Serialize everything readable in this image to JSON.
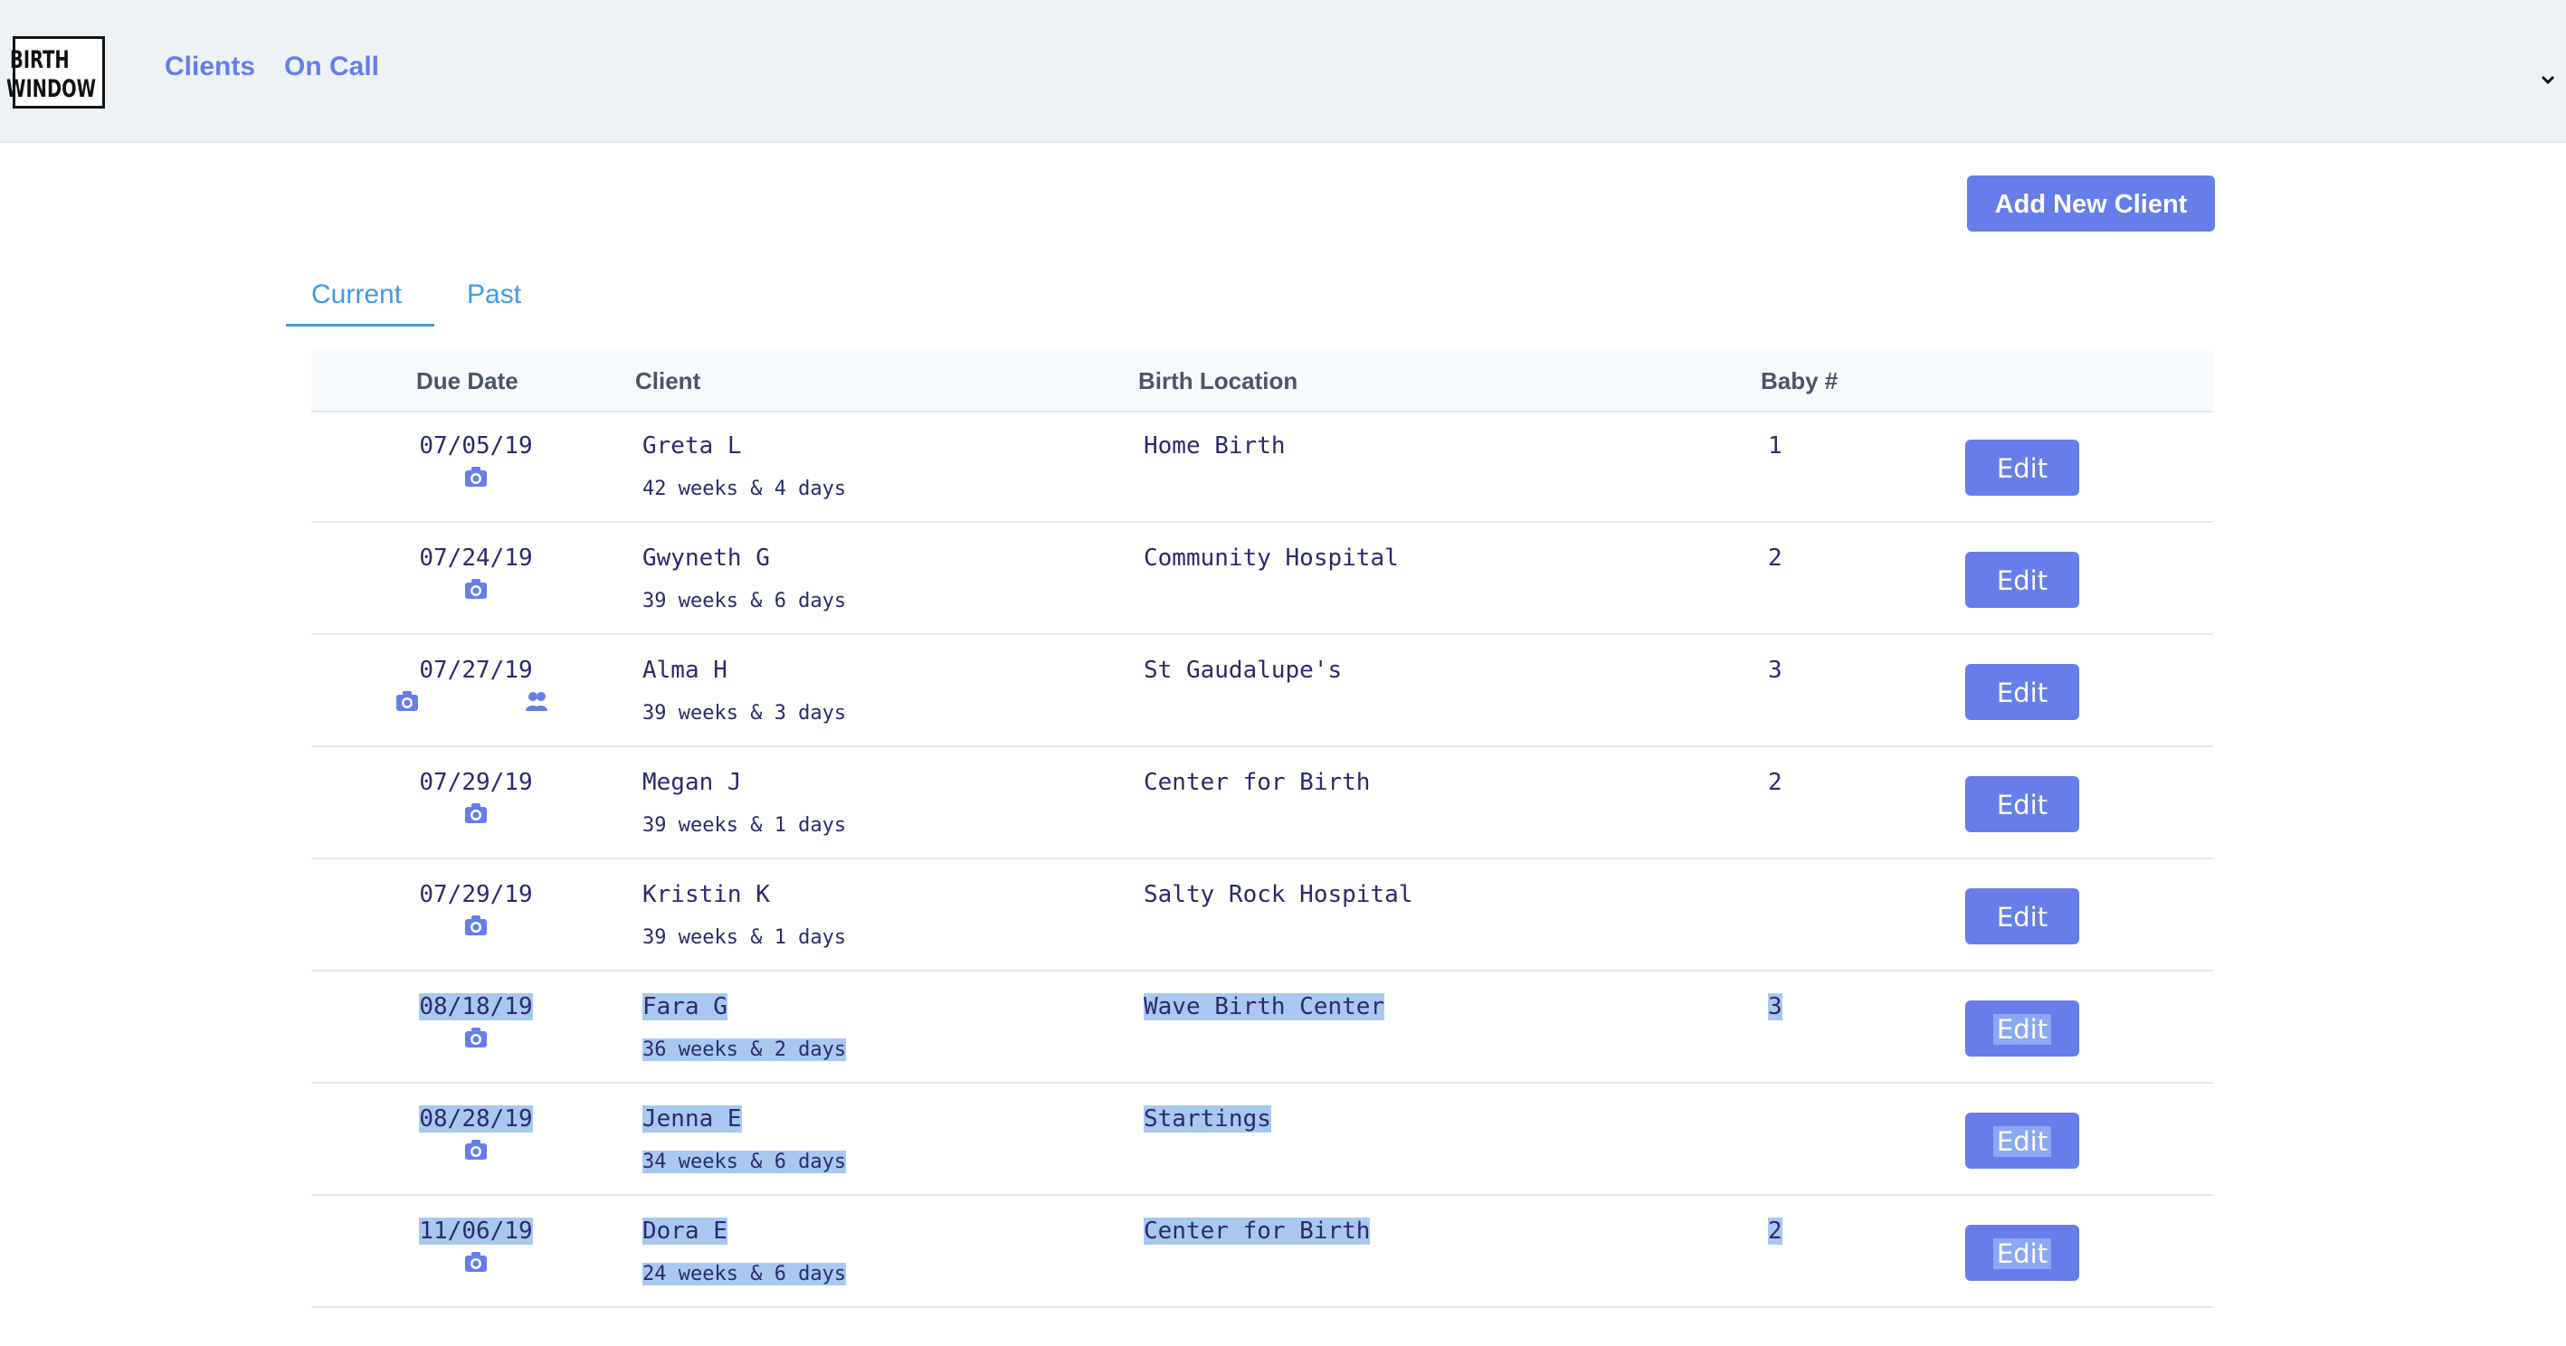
{
  "logo": {
    "line1": "BIRTH",
    "line2": "WINDOW"
  },
  "nav": {
    "clients": "Clients",
    "on_call": "On Call"
  },
  "actions": {
    "add_client": "Add New Client"
  },
  "tabs": [
    {
      "label": "Current"
    },
    {
      "label": "Past"
    }
  ],
  "table": {
    "headers": {
      "due_date": "Due Date",
      "client": "Client",
      "location": "Birth Location",
      "baby": "Baby #"
    },
    "edit_label": "Edit",
    "rows": [
      {
        "due": "07/05/19",
        "name": "Greta L",
        "weeks": "42 weeks & 4 days",
        "location": "Home Birth",
        "baby": "1",
        "icons": [
          "camera-icon"
        ]
      },
      {
        "due": "07/24/19",
        "name": "Gwyneth G",
        "weeks": "39 weeks & 6 days",
        "location": "Community Hospital",
        "baby": "2",
        "icons": [
          "camera-icon"
        ]
      },
      {
        "due": "07/27/19",
        "name": "Alma H",
        "weeks": "39 weeks & 3 days",
        "location": "St Gaudalupe's",
        "baby": "3",
        "icons": [
          "camera-icon",
          "people-icon"
        ]
      },
      {
        "due": "07/29/19",
        "name": "Megan J",
        "weeks": "39 weeks & 1 days",
        "location": "Center for Birth",
        "baby": "2",
        "icons": [
          "camera-icon"
        ]
      },
      {
        "due": "07/29/19",
        "name": "Kristin K",
        "weeks": "39 weeks & 1 days",
        "location": "Salty Rock Hospital",
        "baby": "",
        "icons": [
          "camera-icon"
        ]
      },
      {
        "due": "08/18/19",
        "name": "Fara G",
        "weeks": "36 weeks & 2 days",
        "location": "Wave Birth Center",
        "baby": "3",
        "icons": [
          "camera-icon"
        ]
      },
      {
        "due": "08/28/19",
        "name": "Jenna E",
        "weeks": "34 weeks & 6 days",
        "location": "Startings",
        "baby": "",
        "icons": [
          "camera-icon"
        ]
      },
      {
        "due": "11/06/19",
        "name": "Dora E",
        "weeks": "24 weeks & 6 days",
        "location": "Center for Birth",
        "baby": "2",
        "icons": [
          "camera-icon"
        ]
      }
    ]
  },
  "colors": {
    "accent": "#667eea",
    "tab": "#4299e1",
    "selection": "#a8c8f0",
    "nav_bg": "#edf2f7"
  }
}
